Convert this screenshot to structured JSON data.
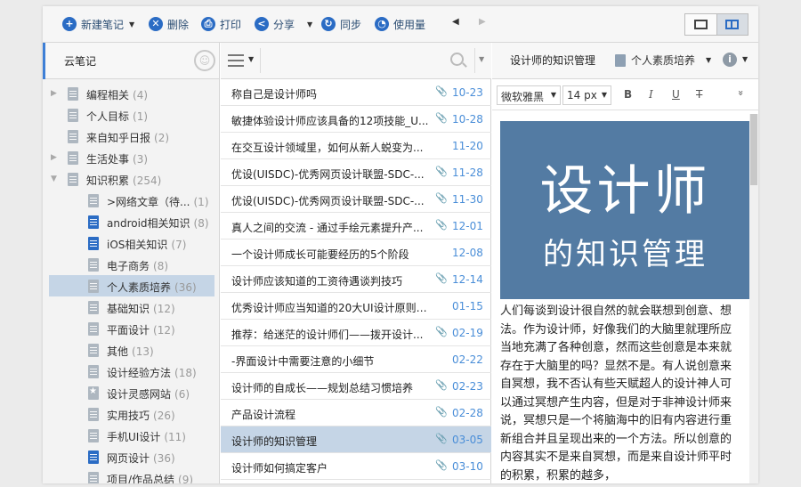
{
  "toolbar": {
    "new_note": "新建笔记",
    "delete": "删除",
    "print": "打印",
    "share": "分享",
    "sync": "同步",
    "usage": "使用量"
  },
  "sidebar": {
    "title": "云笔记",
    "items": [
      {
        "label": "编程相关",
        "count": "(4)",
        "indent": 0,
        "expand": "right",
        "icon": "grey",
        "selected": false
      },
      {
        "label": "个人目标",
        "count": "(1)",
        "indent": 0,
        "expand": "",
        "icon": "grey",
        "selected": false
      },
      {
        "label": "来自知乎日报",
        "count": "(2)",
        "indent": 0,
        "expand": "",
        "icon": "grey",
        "selected": false
      },
      {
        "label": "生活处事",
        "count": "(3)",
        "indent": 0,
        "expand": "right",
        "icon": "grey",
        "selected": false
      },
      {
        "label": "知识积累",
        "count": "(254)",
        "indent": 0,
        "expand": "down",
        "icon": "grey",
        "selected": false
      },
      {
        "label": ">网络文章（待...",
        "count": "(1)",
        "indent": 1,
        "expand": "",
        "icon": "grey",
        "selected": false
      },
      {
        "label": "android相关知识",
        "count": "(8)",
        "indent": 1,
        "expand": "",
        "icon": "blue",
        "selected": false
      },
      {
        "label": "iOS相关知识",
        "count": "(7)",
        "indent": 1,
        "expand": "",
        "icon": "blue",
        "selected": false
      },
      {
        "label": "电子商务",
        "count": "(8)",
        "indent": 1,
        "expand": "",
        "icon": "grey",
        "selected": false
      },
      {
        "label": "个人素质培养",
        "count": "(36)",
        "indent": 1,
        "expand": "",
        "icon": "grey",
        "selected": true
      },
      {
        "label": "基础知识",
        "count": "(12)",
        "indent": 1,
        "expand": "",
        "icon": "grey",
        "selected": false
      },
      {
        "label": "平面设计",
        "count": "(12)",
        "indent": 1,
        "expand": "",
        "icon": "grey",
        "selected": false
      },
      {
        "label": "其他",
        "count": "(13)",
        "indent": 1,
        "expand": "",
        "icon": "grey",
        "selected": false
      },
      {
        "label": "设计经验方法",
        "count": "(18)",
        "indent": 1,
        "expand": "",
        "icon": "grey",
        "selected": false
      },
      {
        "label": "设计灵感网站",
        "count": "(6)",
        "indent": 1,
        "expand": "",
        "icon": "star",
        "selected": false
      },
      {
        "label": "实用技巧",
        "count": "(26)",
        "indent": 1,
        "expand": "",
        "icon": "grey",
        "selected": false
      },
      {
        "label": "手机UI设计",
        "count": "(11)",
        "indent": 1,
        "expand": "",
        "icon": "grey",
        "selected": false
      },
      {
        "label": "网页设计",
        "count": "(36)",
        "indent": 1,
        "expand": "",
        "icon": "blue",
        "selected": false
      },
      {
        "label": "项目/作品总结",
        "count": "(9)",
        "indent": 1,
        "expand": "",
        "icon": "grey",
        "selected": false
      }
    ]
  },
  "notes": [
    {
      "title": "称自己是设计师吗",
      "date": "10-23",
      "attachment": true,
      "selected": false
    },
    {
      "title": "敏捷体验设计师应该具备的12项技能_U...",
      "date": "10-28",
      "attachment": true,
      "selected": false
    },
    {
      "title": "在交互设计领域里，如何从新人蜕变为...",
      "date": "11-20",
      "attachment": false,
      "selected": false
    },
    {
      "title": "优设(UISDC)-优秀网页设计联盟-SDC-...",
      "date": "11-28",
      "attachment": true,
      "selected": false
    },
    {
      "title": "优设(UISDC)-优秀网页设计联盟-SDC-...",
      "date": "11-30",
      "attachment": true,
      "selected": false
    },
    {
      "title": "真人之间的交流 - 通过手绘元素提升产...",
      "date": "12-01",
      "attachment": true,
      "selected": false
    },
    {
      "title": "一个设计师成长可能要经历的5个阶段",
      "date": "12-08",
      "attachment": false,
      "selected": false
    },
    {
      "title": "设计师应该知道的工资待遇谈判技巧",
      "date": "12-14",
      "attachment": true,
      "selected": false
    },
    {
      "title": "优秀设计师应当知道的20大UI设计原则_...",
      "date": "01-15",
      "attachment": false,
      "selected": false
    },
    {
      "title": "推荐：给迷茫的设计师们——拨开设计...",
      "date": "02-19",
      "attachment": true,
      "selected": false
    },
    {
      "title": "-界面设计中需要注意的小细节",
      "date": "02-22",
      "attachment": false,
      "selected": false
    },
    {
      "title": "设计师的自成长——规划总结习惯培养",
      "date": "02-23",
      "attachment": true,
      "selected": false
    },
    {
      "title": "产品设计流程",
      "date": "02-28",
      "attachment": true,
      "selected": false
    },
    {
      "title": "设计师的知识管理",
      "date": "03-05",
      "attachment": true,
      "selected": true
    },
    {
      "title": "设计师如何搞定客户",
      "date": "03-10",
      "attachment": true,
      "selected": false
    }
  ],
  "editor": {
    "title": "设计师的知识管理",
    "notebook": "个人素质培养",
    "font_family": "微软雅黑",
    "font_size": "14 px",
    "bold": "B",
    "italic": "I",
    "underline": "U",
    "strike": "T",
    "hero_line1": "设计师",
    "hero_line2": "的知识管理",
    "body": "人们每谈到设计很自然的就会联想到创意、想法。作为设计师，好像我们的大脑里就理所应当地充满了各种创意，然而这些创意是本来就存在于大脑里的吗？显然不是。有人说创意来自冥想，我不否认有些天赋超人的设计神人可以通过冥想产生内容，但是对于非神设计师来说，冥想只是一个将脑海中的旧有内容进行重新组合并且呈现出来的一个方法。所以创意的内容其实不是来自冥想，而是来自设计师平时的积累，积累的越多，"
  },
  "colors": {
    "accent": "#2b6cc4",
    "selection": "#c5d5e6",
    "date": "#4a8ed8",
    "hero": "#537ba3"
  }
}
